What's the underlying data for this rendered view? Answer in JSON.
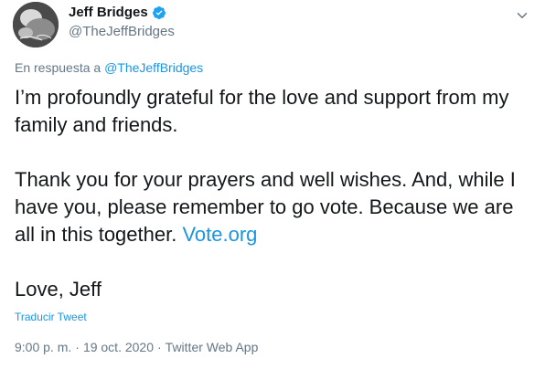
{
  "author": {
    "display_name": "Jeff Bridges",
    "handle": "@TheJeffBridges",
    "verified": true
  },
  "reply_context": {
    "prefix": "En respuesta a ",
    "mention": "@TheJeffBridges"
  },
  "tweet": {
    "para1": "I’m profoundly grateful for the love and support from my family and friends.",
    "para2_text": "Thank you for your prayers and well wishes.  And, while I have you, please remember to go vote. Because we are all in this together. ",
    "para2_link": "Vote.org",
    "para3": "Love, Jeff"
  },
  "translate_label": "Traducir Tweet",
  "meta": {
    "time": "9:00 p. m.",
    "separator": "·",
    "date": "19 oct. 2020",
    "source": "Twitter Web App"
  },
  "icons": {
    "verified": "verified-badge-icon",
    "caret": "chevron-down-icon"
  },
  "colors": {
    "link": "#1b95e0",
    "secondary_text": "#657786",
    "primary_text": "#14171a",
    "verified": "#1da1f2"
  }
}
